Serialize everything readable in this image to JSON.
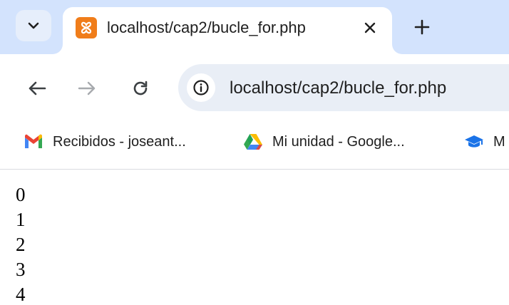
{
  "tab": {
    "title": "localhost/cap2/bucle_for.php",
    "close_icon": "close-icon",
    "favicon_icon": "xampp-icon"
  },
  "toolbar": {
    "url": "localhost/cap2/bucle_for.php",
    "back_icon": "arrow-left-icon",
    "forward_icon": "arrow-right-icon",
    "reload_icon": "reload-icon",
    "site_info_icon": "info-icon"
  },
  "bookmarks": [
    {
      "label": "Recibidos - joseant...",
      "icon": "gmail-icon"
    },
    {
      "label": "Mi unidad - Google...",
      "icon": "google-drive-icon"
    },
    {
      "label": "M",
      "icon": "graduation-cap-icon"
    }
  ],
  "page": {
    "output": [
      "0",
      "1",
      "2",
      "3",
      "4"
    ]
  },
  "colors": {
    "tab_strip": "#d3e3fd",
    "omnibox": "#e9eef6",
    "favicon": "#f07d1a"
  }
}
